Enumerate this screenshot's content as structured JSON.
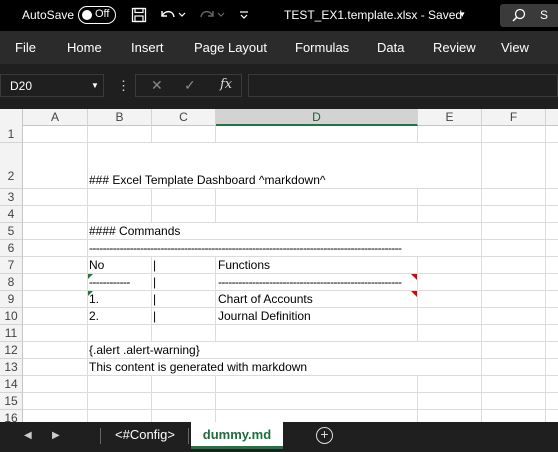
{
  "titlebar": {
    "autosave_label": "AutoSave",
    "toggle_state": "Off",
    "doc_title": "TEST_EX1.template.xlsx  -  Saved",
    "search_label": "S"
  },
  "ribbon": {
    "tabs": [
      "File",
      "Home",
      "Insert",
      "Page Layout",
      "Formulas",
      "Data",
      "Review",
      "View"
    ]
  },
  "formula_bar": {
    "name_box": "D20",
    "formula": ""
  },
  "grid": {
    "columns": [
      "A",
      "B",
      "C",
      "D",
      "E",
      "F"
    ],
    "selected_column": "D",
    "rows": [
      "1",
      "2",
      "3",
      "4",
      "5",
      "6",
      "7",
      "8",
      "9",
      "10",
      "11",
      "12",
      "13",
      "14",
      "15",
      "16"
    ],
    "cells": {
      "B2": "### Excel Template Dashboard ^markdown^",
      "B4": "#### Commands",
      "B5": "--------------------------------------------------------------------------------------------",
      "B6": "No",
      "C6": "|",
      "D6": "Functions",
      "B7": "------------",
      "C7": "|",
      "D7": "------------------------------------------------------",
      "B8": "1.",
      "C8": "|",
      "D8": "Chart of Accounts",
      "B9": "2.",
      "C9": "|",
      "D9": "Journal Definition",
      "B11": "{.alert .alert-warning}",
      "B12": "This content is generated with markdown"
    }
  },
  "sheets": {
    "tabs": [
      "<#Config>",
      "dummy.md"
    ],
    "active": "dummy.md"
  },
  "colors": {
    "accent": "#217346",
    "chrome_dark": "#1f1f1f"
  }
}
